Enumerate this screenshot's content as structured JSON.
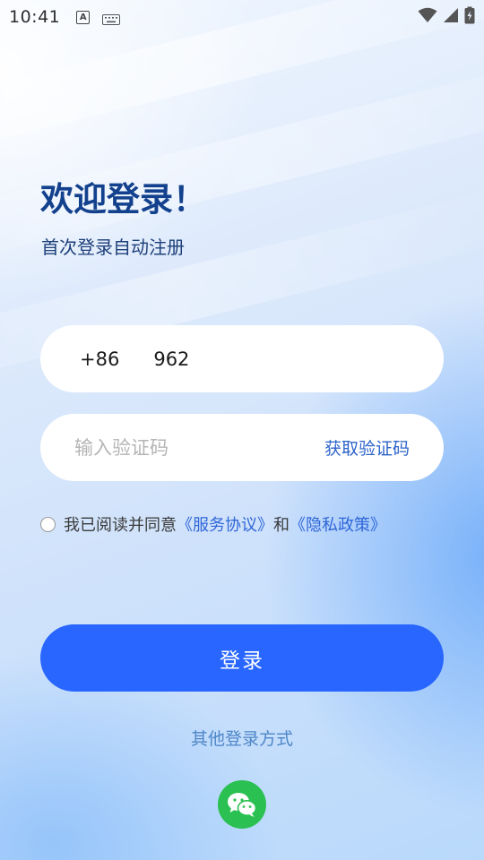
{
  "status_bar": {
    "time": "10:41",
    "icons": [
      "a-notification-icon",
      "keyboard-icon",
      "wifi-icon",
      "signal-icon",
      "battery-charging-icon"
    ]
  },
  "header": {
    "title": "欢迎登录！",
    "subtitle": "首次登录自动注册"
  },
  "phone_field": {
    "country_code": "+86",
    "value": "962"
  },
  "code_field": {
    "placeholder": "输入验证码",
    "get_code_label": "获取验证码"
  },
  "agreement": {
    "checked": false,
    "prefix": "我已阅读并同意",
    "service_link": "《服务协议》",
    "conjunction": "和",
    "privacy_link": "《隐私政策》"
  },
  "login_button": {
    "label": "登录"
  },
  "other_login": {
    "label": "其他登录方式",
    "methods": [
      "wechat-icon"
    ]
  },
  "colors": {
    "primary": "#2866ff",
    "title": "#13418d",
    "link": "#2f66d8",
    "wechat": "#2ac052"
  }
}
